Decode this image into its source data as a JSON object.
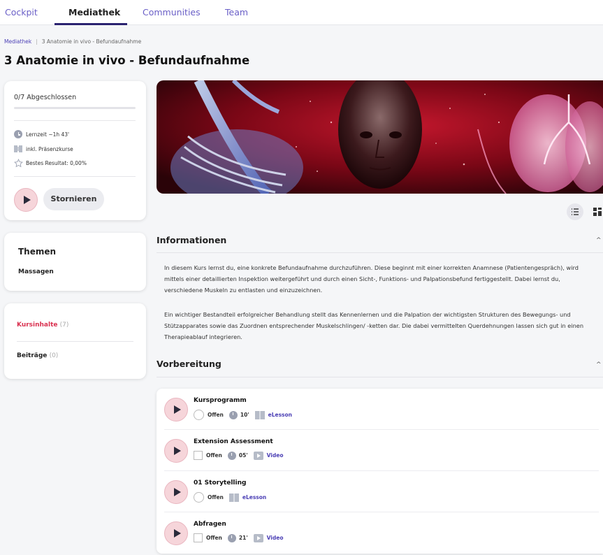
{
  "nav": {
    "items": [
      {
        "label": "Cockpit",
        "active": false
      },
      {
        "label": "Mediathek",
        "active": true
      },
      {
        "label": "Communities",
        "active": false
      },
      {
        "label": "Team",
        "active": false
      }
    ]
  },
  "breadcrumb": {
    "root": "Mediathek",
    "current": "3 Anatomie in vivo - Befundaufnahme"
  },
  "page": {
    "title": "3 Anatomie in vivo - Befundaufnahme"
  },
  "progress_card": {
    "progress_label": "0/7 Abgeschlossen",
    "progress_fraction": 0,
    "learning_time": "Lernzeit ~1h 43'",
    "presence": "inkl. Präsenzkurse",
    "best_result": "Bestes Resultat: 0,00%",
    "cancel_label": "Stornieren"
  },
  "themes_card": {
    "title": "Themen",
    "item": "Massagen"
  },
  "tabs_card": {
    "tabs": [
      {
        "label": "Kursinhalte",
        "count": "(7)",
        "active": true
      },
      {
        "label": "Beiträge",
        "count": "(0)",
        "active": false
      }
    ]
  },
  "info": {
    "title": "Informationen",
    "paragraphs": [
      "In diesem Kurs lernst du, eine konkrete Befundaufnahme durchzuführen. Diese beginnt mit einer korrekten Anamnese (Patientengespräch), wird mittels einer detaillierten Inspektion weitergeführt und durch einen Sicht-, Funktions- und Palpationsbefund fertiggestellt. Dabei lernst du, verschiedene Muskeln zu entlasten und einzuzeichnen.",
      "Ein wichtiger Bestandteil erfolgreicher Behandlung stellt das Kennenlernen und die Palpation der wichtigsten Strukturen des Bewegungs- und Stützapparates sowie das Zuordnen entsprechender Muskelschlingen/ -ketten dar. Die dabei vermittelten Querdehnungen lassen sich gut in einen Therapieablauf integrieren."
    ]
  },
  "prep": {
    "title": "Vorbereitung"
  },
  "lessons": [
    {
      "title": "Kursprogramm",
      "status": "Offen",
      "duration": "10'",
      "type": "eLesson",
      "status_shape": "circle"
    },
    {
      "title": "Extension Assessment",
      "status": "Offen",
      "duration": "05'",
      "type": "Video",
      "status_shape": "box"
    },
    {
      "title": "01 Storytelling",
      "status": "Offen",
      "duration": "",
      "type": "eLesson",
      "status_shape": "circle"
    },
    {
      "title": "Abfragen",
      "status": "Offen",
      "duration": "21'",
      "type": "Video",
      "status_shape": "box"
    }
  ],
  "colors": {
    "accent": "#6a5fc7",
    "active_tab": "#d9304f",
    "nav_underline": "#2b2370"
  }
}
